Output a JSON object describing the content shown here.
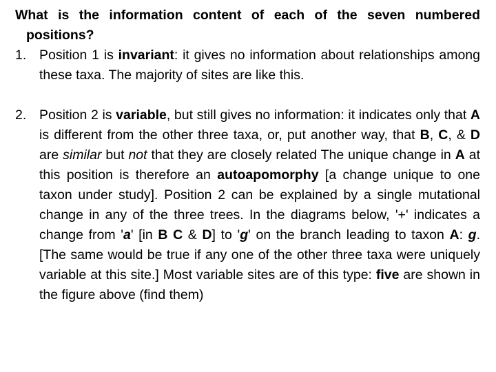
{
  "slide": {
    "heading": "What is the information content of each of the seven numbered positions?",
    "items": [
      {
        "marker": "1.",
        "segments": [
          {
            "text": "Position 1 is ",
            "style": "normal"
          },
          {
            "text": "invariant",
            "style": "bold"
          },
          {
            "text": ": it gives no information about relationships among these taxa. The majority of sites are like this.",
            "style": "normal"
          }
        ],
        "plain": "Position 1 is invariant: it gives no information about relationships among these taxa. The majority of sites are like this."
      },
      {
        "marker": "2.",
        "segments": [
          {
            "text": "Position 2 is ",
            "style": "normal"
          },
          {
            "text": "variable",
            "style": "bold"
          },
          {
            "text": ", but still gives no information: it indicates only that ",
            "style": "normal"
          },
          {
            "text": "A",
            "style": "bold"
          },
          {
            "text": " is different from the other three taxa, or, put another way, that ",
            "style": "normal"
          },
          {
            "text": "B",
            "style": "bold"
          },
          {
            "text": ", ",
            "style": "normal"
          },
          {
            "text": "C",
            "style": "bold"
          },
          {
            "text": ", & ",
            "style": "normal"
          },
          {
            "text": "D",
            "style": "bold"
          },
          {
            "text": " are ",
            "style": "normal"
          },
          {
            "text": "similar",
            "style": "italic"
          },
          {
            "text": " but ",
            "style": "normal"
          },
          {
            "text": "not",
            "style": "italic"
          },
          {
            "text": " that they are closely related The unique change in ",
            "style": "normal"
          },
          {
            "text": "A",
            "style": "bold"
          },
          {
            "text": " at this position is therefore an ",
            "style": "normal"
          },
          {
            "text": "autoapomorphy",
            "style": "bold"
          },
          {
            "text": " [a change unique to one taxon under study]. Position 2 can be explained by a single mutational change in any of the three trees. In the diagrams below, '+' indicates a change from '",
            "style": "normal"
          },
          {
            "text": "a",
            "style": "bold-italic"
          },
          {
            "text": "' [in ",
            "style": "normal"
          },
          {
            "text": "B C",
            "style": "bold"
          },
          {
            "text": " & ",
            "style": "normal"
          },
          {
            "text": "D",
            "style": "bold"
          },
          {
            "text": "] to '",
            "style": "normal"
          },
          {
            "text": "g",
            "style": "bold-italic"
          },
          {
            "text": "' on the branch leading to taxon ",
            "style": "normal"
          },
          {
            "text": "A",
            "style": "bold"
          },
          {
            "text": ":  ",
            "style": "normal"
          },
          {
            "text": "g",
            "style": "bold-italic"
          },
          {
            "text": ". [The same would be true if any one of the other three taxa were uniquely variable at this site.] Most variable sites are of this type: ",
            "style": "normal"
          },
          {
            "text": "five",
            "style": "bold"
          },
          {
            "text": " are shown in the figure above (find them)",
            "style": "normal"
          }
        ],
        "plain": "Position 2 is variable, but still gives no information: it indicates only that A is different from the other three taxa, or, put another way, that B, C, & D are similar but not that they are closely related The unique change in A at this position is therefore an autoapomorphy [a change unique to one taxon under study]. Position 2 can be explained by a single mutational change in any of the three trees. In the diagrams below, '+' indicates a change from 'a' [in B C & D] to 'g' on the branch leading to taxon A:  g. [The same would be true if any one of the other three taxa were uniquely variable at this site.] Most variable sites are of this type: five are shown in the figure above (find them)"
      }
    ]
  }
}
